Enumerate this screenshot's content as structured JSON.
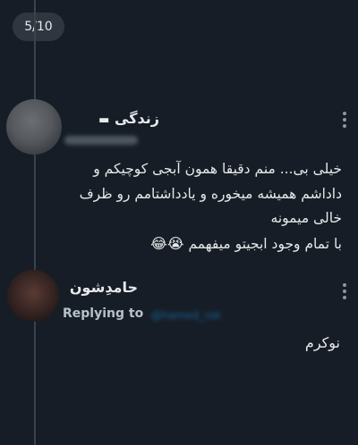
{
  "counter": "5/10",
  "tweet": {
    "author_name": "زندگی",
    "author_mark": "▬",
    "lines": [
      "خیلی بی... منم دقیقا همون آبجی کوچیکم و",
      "داداشم همیشه میخوره و یادداشتامم رو ظرف",
      "خالی میمونه",
      "با تمام وجود ابجیتو میفهمم"
    ],
    "emojis": "😭😂"
  },
  "reply": {
    "author_name": "حامدِشون",
    "replying_label": "Replying to",
    "replying_handle": "@hamed_rok",
    "text": "نوکرم"
  }
}
